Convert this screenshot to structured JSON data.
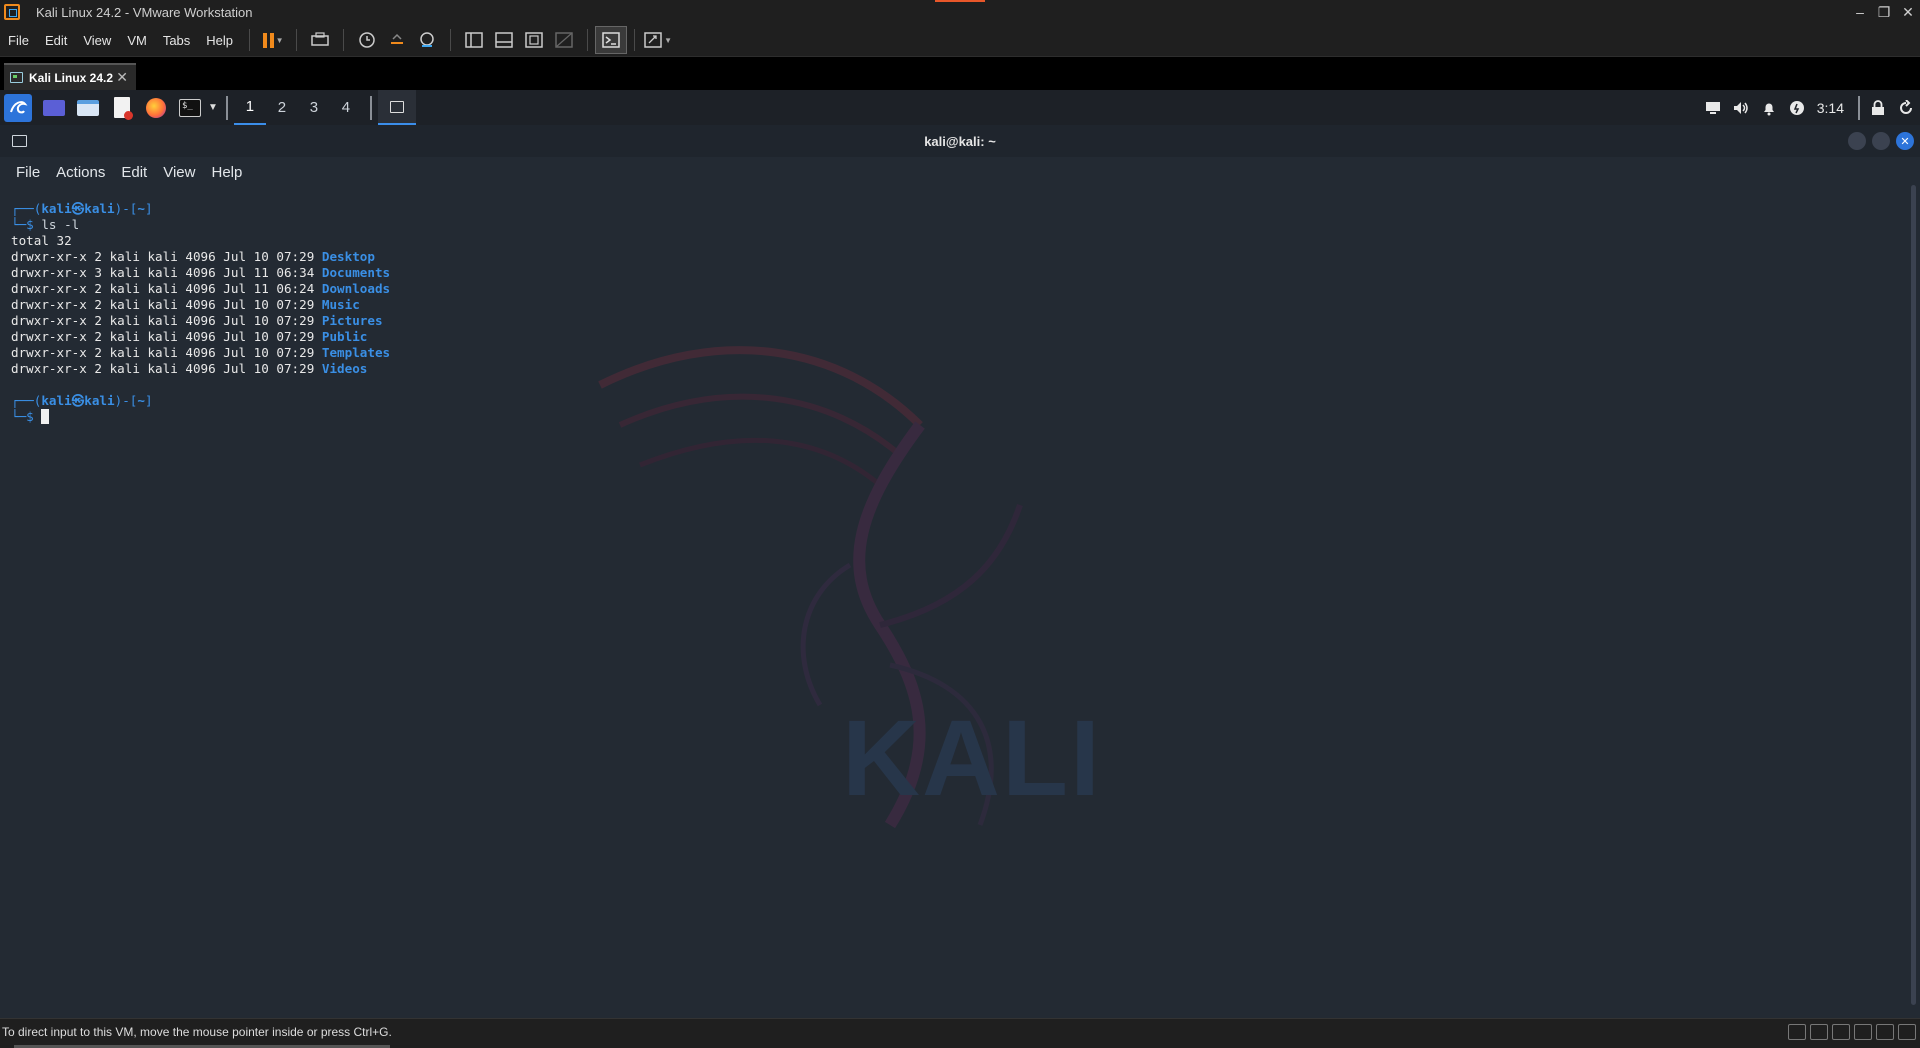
{
  "vmware": {
    "title": "Kali Linux 24.2 - VMware Workstation",
    "menu": [
      "File",
      "Edit",
      "View",
      "VM",
      "Tabs",
      "Help"
    ],
    "tab_label": "Kali Linux 24.2",
    "tab_close": "✕",
    "status_message": "To direct input to this VM, move the mouse pointer inside or press Ctrl+G.",
    "window_controls": {
      "minimize": "–",
      "maximize": "❐",
      "close": "✕"
    }
  },
  "kali_panel": {
    "workspaces": [
      "1",
      "2",
      "3",
      "4"
    ],
    "active_workspace": "1",
    "clock": "3:14",
    "icons": [
      "kali-menu-icon",
      "desktop-icon",
      "file-manager-icon",
      "text-editor-icon",
      "firefox-icon",
      "terminal-icon",
      "volume-icon",
      "notifications-icon",
      "power-icon",
      "lock-icon",
      "logout-icon"
    ]
  },
  "terminal": {
    "title": "kali@kali: ~",
    "menu": [
      "File",
      "Actions",
      "Edit",
      "View",
      "Help"
    ],
    "prompt1": {
      "top": "┌──(",
      "user": "kali㉿kali",
      "mid": ")-[",
      "dir": "~",
      "end": "]",
      "bottom": "└─$ ",
      "command": "ls -l"
    },
    "total": "total 32",
    "listing": [
      {
        "perm": "drwxr-xr-x 2 kali kali 4096 Jul 10 07:29 ",
        "name": "Desktop"
      },
      {
        "perm": "drwxr-xr-x 3 kali kali 4096 Jul 11 06:34 ",
        "name": "Documents"
      },
      {
        "perm": "drwxr-xr-x 2 kali kali 4096 Jul 11 06:24 ",
        "name": "Downloads"
      },
      {
        "perm": "drwxr-xr-x 2 kali kali 4096 Jul 10 07:29 ",
        "name": "Music"
      },
      {
        "perm": "drwxr-xr-x 2 kali kali 4096 Jul 10 07:29 ",
        "name": "Pictures"
      },
      {
        "perm": "drwxr-xr-x 2 kali kali 4096 Jul 10 07:29 ",
        "name": "Public"
      },
      {
        "perm": "drwxr-xr-x 2 kali kali 4096 Jul 10 07:29 ",
        "name": "Templates"
      },
      {
        "perm": "drwxr-xr-x 2 kali kali 4096 Jul 10 07:29 ",
        "name": "Videos"
      }
    ],
    "prompt2": {
      "top": "┌──(",
      "user": "kali㉿kali",
      "mid": ")-[",
      "dir": "~",
      "end": "]",
      "bottom": "└─$ "
    },
    "wallpaper_text": "KALI"
  },
  "colors": {
    "accent": "#3a8fe5",
    "vmware_orange": "#f08a1c",
    "terminal_bg": "#232a33"
  }
}
